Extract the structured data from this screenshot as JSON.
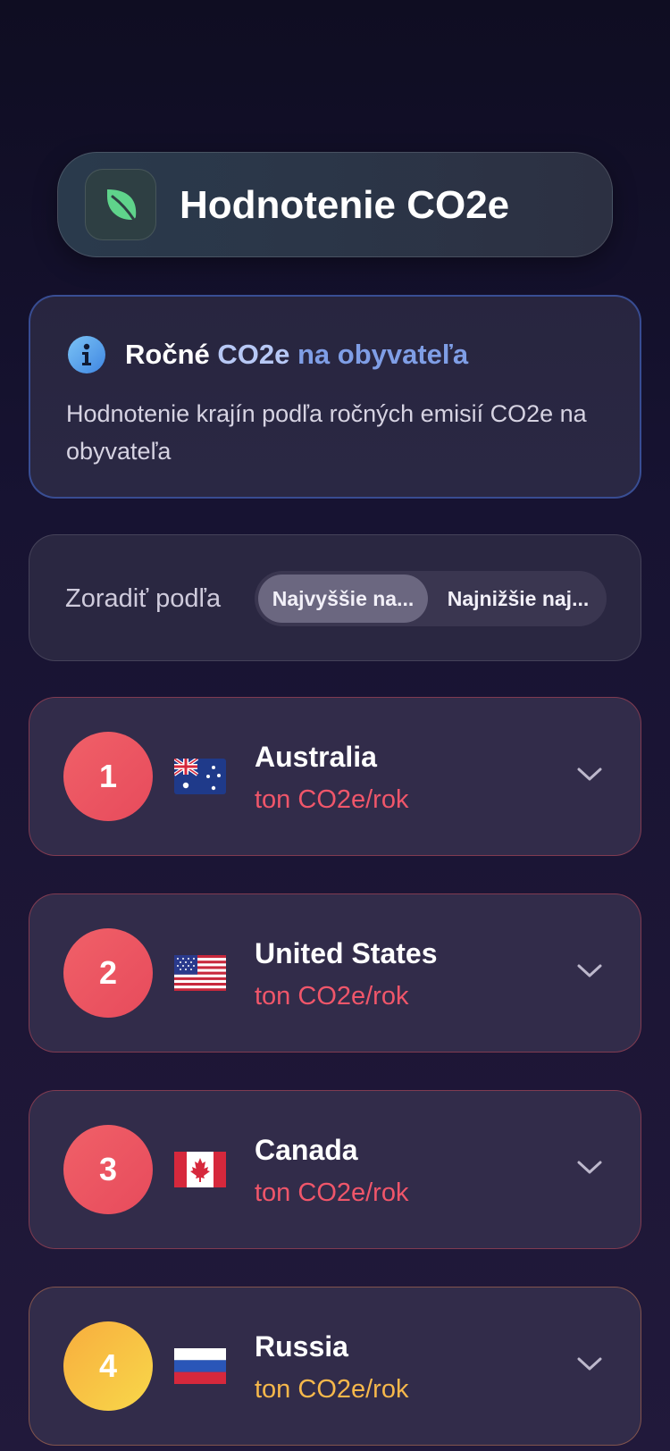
{
  "header": {
    "title": "Hodnotenie CO2e",
    "logo_icon": "leaf-icon",
    "accent": "#5fd38b"
  },
  "info": {
    "icon": "info-icon",
    "title_part1": "Ročné",
    "title_part2": " CO2e",
    "title_part3": " na obyvateľa",
    "description": "Hodnotenie krajín podľa ročných emisií CO2e na obyvateľa"
  },
  "sort": {
    "label": "Zoradiť podľa",
    "options": [
      "Najvyššie na...",
      "Najnižšie naj..."
    ],
    "selected_index": 0
  },
  "countries": [
    {
      "rank": "1",
      "name": "Australia",
      "unit": "ton CO2e/rok",
      "flag": "australia-flag-icon",
      "color": "#e74b5c"
    },
    {
      "rank": "2",
      "name": "United States",
      "unit": "ton CO2e/rok",
      "flag": "united-states-flag-icon",
      "color": "#e74b5c"
    },
    {
      "rank": "3",
      "name": "Canada",
      "unit": "ton CO2e/rok",
      "flag": "canada-flag-icon",
      "color": "#e74b5c"
    },
    {
      "rank": "4",
      "name": "Russia",
      "unit": "ton CO2e/rok",
      "flag": "russia-flag-icon",
      "color": "#f7b84b"
    }
  ]
}
